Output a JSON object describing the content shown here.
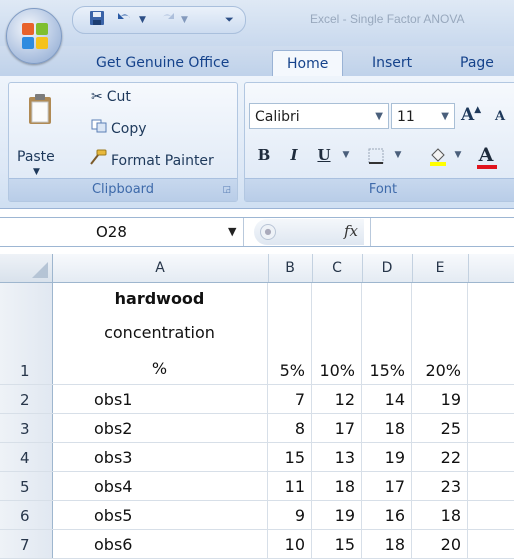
{
  "title_bar": {
    "qat_icons": [
      "save-icon",
      "undo-icon",
      "redo-icon",
      "customize-icon"
    ],
    "document_title": "Excel - Single Factor ANOVA"
  },
  "tabs": [
    "Get Genuine Office",
    "Home",
    "Insert",
    "Page La"
  ],
  "active_tab": "Home",
  "clipboard": {
    "paste": "Paste",
    "cut": "Cut",
    "copy": "Copy",
    "format_painter": "Format Painter",
    "label": "Clipboard"
  },
  "font": {
    "family": "Calibri",
    "size": "11",
    "bold": "B",
    "italic": "I",
    "underline": "U",
    "grow": "A",
    "shrink": "A",
    "font_color": "A",
    "label": "Font"
  },
  "formula_bar": {
    "name_box": "O28",
    "fx": "fx",
    "formula": ""
  },
  "sheet": {
    "columns": [
      "A",
      "B",
      "C",
      "D",
      "E"
    ],
    "header_cell": [
      "hardwood",
      "concentration",
      "%"
    ],
    "header_values": [
      "5%",
      "10%",
      "15%",
      "20%"
    ],
    "rows": [
      {
        "num": "1"
      },
      {
        "num": "2",
        "label": "obs1",
        "values": [
          "7",
          "12",
          "14",
          "19"
        ]
      },
      {
        "num": "3",
        "label": "obs2",
        "values": [
          "8",
          "17",
          "18",
          "25"
        ]
      },
      {
        "num": "4",
        "label": "obs3",
        "values": [
          "15",
          "13",
          "19",
          "22"
        ]
      },
      {
        "num": "5",
        "label": "obs4",
        "values": [
          "11",
          "18",
          "17",
          "23"
        ]
      },
      {
        "num": "6",
        "label": "obs5",
        "values": [
          "9",
          "19",
          "16",
          "18"
        ]
      },
      {
        "num": "7",
        "label": "obs6",
        "values": [
          "10",
          "15",
          "18",
          "20"
        ]
      }
    ]
  },
  "colors": {
    "ribbon_blue": "#dde8f6",
    "tab_text": "#15428b",
    "font_color_bar": "#e0141e",
    "highlight_bar": "#ffff00"
  }
}
